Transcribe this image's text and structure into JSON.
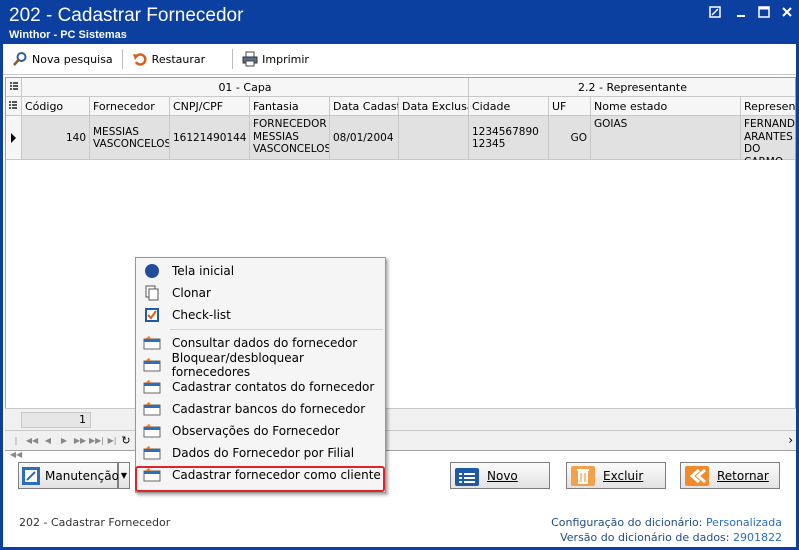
{
  "window": {
    "title": "202 - Cadastrar  Fornecedor",
    "subtitle": "Winthor - PC Sistemas"
  },
  "toolbar": {
    "search_label": "Nova pesquisa",
    "restore_label": "Restaurar",
    "print_label": "Imprimir"
  },
  "grid": {
    "bands": [
      {
        "label": "01 - Capa"
      },
      {
        "label": "2.2 - Representante"
      }
    ],
    "columns": [
      "Código",
      "Fornecedor",
      "CNPJ/CPF",
      "Fantasia",
      "Data Cadastro",
      "Data Exclusão",
      "Cidade",
      "UF",
      "Nome estado",
      "Representante"
    ],
    "rows": [
      {
        "codigo": "140",
        "fornecedor": "MESSIAS VASCONCELOS",
        "cnpj": "16121490144",
        "fantasia": "FORNECEDOR MESSIAS VASCONCELOS",
        "data_cadastro": "08/01/2004",
        "data_exclusao": "",
        "cidade": "123456789012345",
        "uf": "GO",
        "nome_estado": "GOIAS",
        "representante": "FERNANDO ARANTES DO CARMO"
      }
    ]
  },
  "statusbar": {
    "page_value": "1"
  },
  "context_menu": {
    "items": [
      {
        "label": "Tela inicial",
        "icon": "compass-icon"
      },
      {
        "label": "Clonar",
        "icon": "copy-icon"
      },
      {
        "label": "Check-list",
        "icon": "checkbox-icon"
      },
      {
        "label": "Consultar dados do fornecedor",
        "icon": "window-form-icon"
      },
      {
        "label": "Bloquear/desbloquear fornecedores",
        "icon": "window-form-icon"
      },
      {
        "label": "Cadastrar contatos do fornecedor",
        "icon": "window-form-icon"
      },
      {
        "label": "Cadastrar bancos do fornecedor",
        "icon": "window-form-icon"
      },
      {
        "label": "Observações do Fornecedor",
        "icon": "window-form-icon"
      },
      {
        "label": "Dados do Fornecedor por Filial",
        "icon": "window-form-icon"
      },
      {
        "label": "Cadastrar fornecedor como cliente",
        "icon": "window-form-icon"
      }
    ]
  },
  "buttons": {
    "manutencao": "Manutenção",
    "novo": "Novo",
    "excluir": "Excluir",
    "retornar": "Retornar"
  },
  "footer": {
    "left_text": "202 - Cadastrar  Fornecedor",
    "config_label": "Configuração do dicionário:",
    "config_value": "Personalizada",
    "version_label": "Versão do dicionário de dados:",
    "version_value": "2901822"
  },
  "colors": {
    "titlebar": "#0b3fa0",
    "highlight": "#e2232a",
    "selected_row": "#e1e1e1"
  }
}
